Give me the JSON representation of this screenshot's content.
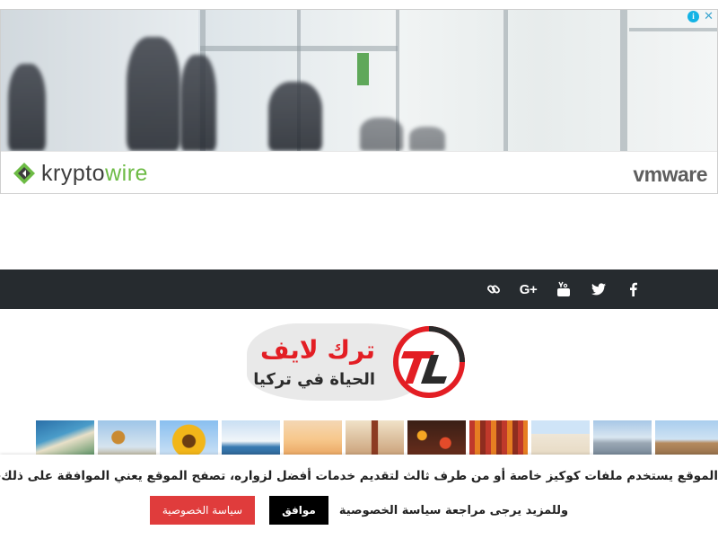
{
  "ad": {
    "advertiser_left": "kryptowire",
    "advertiser_left_parts": [
      "kr",
      "ypto",
      "wire"
    ],
    "advertiser_right": "vmware",
    "info_icon": "info-icon",
    "close_icon": "close-icon"
  },
  "social": {
    "icons": [
      "link-icon",
      "google-plus-icon",
      "youtube-icon",
      "twitter-icon",
      "facebook-icon"
    ],
    "gplus_label": "G+",
    "youtube_label": "You",
    "color": "#ffffff",
    "bar_color": "#262b2f"
  },
  "logo": {
    "title": "ترك لايف",
    "tagline": "الحياة في تركيا",
    "accent_color": "#e31e24"
  },
  "cookie": {
    "message": "الموقع يستخدم ملفات كوكيز خاصة أو من طرف ثالث لتقديم خدمات أفضل لزواره، تصفح الموقع يعني الموافقة على ذلك،",
    "more": "وللمزيد يرجى مراجعة سياسة الخصوصية",
    "agree_label": "موافق",
    "privacy_label": "سياسة الخصوصية",
    "privacy_color": "#e03c3c"
  }
}
